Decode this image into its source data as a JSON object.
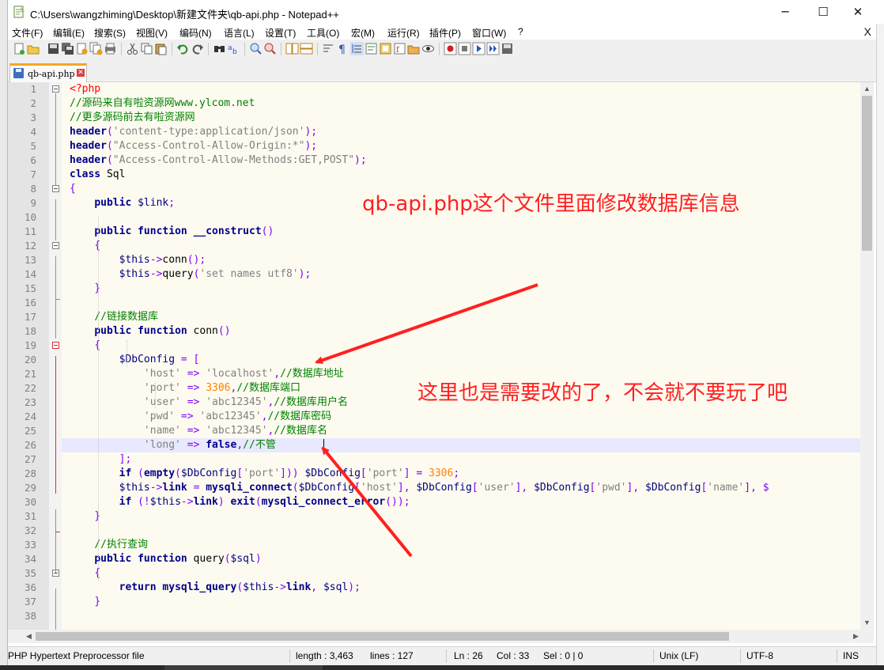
{
  "window": {
    "title": "C:\\Users\\wangzhiming\\Desktop\\新建文件夹\\qb-api.php - Notepad++",
    "minimize": "─",
    "maximize": "☐",
    "close": "✕"
  },
  "menu": {
    "items": [
      "文件(F)",
      "编辑(E)",
      "搜索(S)",
      "视图(V)",
      "编码(N)",
      "语言(L)",
      "设置(T)",
      "工具(O)",
      "宏(M)",
      "运行(R)",
      "插件(P)",
      "窗口(W)",
      "?"
    ],
    "close_doc": "X"
  },
  "toolbar": {
    "icons": [
      "new-file-icon",
      "open-file-icon",
      "save-icon",
      "save-all-icon",
      "close-icon",
      "close-all-icon",
      "print-icon",
      "cut-icon",
      "copy-icon",
      "paste-icon",
      "undo-icon",
      "redo-icon",
      "find-icon",
      "replace-icon",
      "zoom-in-icon",
      "zoom-out-icon",
      "sync-vertical-icon",
      "sync-horizontal-icon",
      "word-wrap-icon",
      "show-all-chars-icon",
      "indent-guide-icon",
      "user-language-icon",
      "doc-map-icon",
      "function-list-icon",
      "folder-workspace-icon",
      "monitoring-icon",
      "record-macro-icon",
      "stop-macro-icon",
      "play-macro-icon",
      "run-macro-multiple-icon",
      "save-macro-icon"
    ]
  },
  "tab": {
    "label": "qb-api.php",
    "close_glyph": "✕"
  },
  "editor": {
    "lines": [
      {
        "n": "1",
        "tokens": [
          [
            "tag",
            "<?php"
          ]
        ]
      },
      {
        "n": "2",
        "tokens": [
          [
            "cmt",
            "//源码来自有啦资源网www.ylcom.net"
          ]
        ]
      },
      {
        "n": "3",
        "tokens": [
          [
            "cmt",
            "//更多源码前去有啦资源网"
          ]
        ]
      },
      {
        "n": "4",
        "tokens": [
          [
            "fn",
            "header"
          ],
          [
            "op",
            "("
          ],
          [
            "str",
            "'content-type:application/json'"
          ],
          [
            "op",
            ");"
          ]
        ]
      },
      {
        "n": "5",
        "tokens": [
          [
            "fn",
            "header"
          ],
          [
            "op",
            "("
          ],
          [
            "str",
            "\"Access-Control-Allow-Origin:*\""
          ],
          [
            "op",
            ");"
          ]
        ]
      },
      {
        "n": "6",
        "tokens": [
          [
            "fn",
            "header"
          ],
          [
            "op",
            "("
          ],
          [
            "str",
            "\"Access-Control-Allow-Methods:GET,POST\""
          ],
          [
            "op",
            ");"
          ]
        ]
      },
      {
        "n": "7",
        "tokens": [
          [
            "kw",
            "class"
          ],
          [
            "plain",
            " Sql"
          ]
        ]
      },
      {
        "n": "8",
        "tokens": [
          [
            "op",
            "{"
          ]
        ]
      },
      {
        "n": "9",
        "tokens": [
          [
            "plain",
            "    "
          ],
          [
            "kw",
            "public"
          ],
          [
            "plain",
            " "
          ],
          [
            "var",
            "$link"
          ],
          [
            "op",
            ";"
          ]
        ]
      },
      {
        "n": "10",
        "tokens": []
      },
      {
        "n": "11",
        "tokens": [
          [
            "plain",
            "    "
          ],
          [
            "kw",
            "public"
          ],
          [
            "plain",
            " "
          ],
          [
            "kw",
            "function"
          ],
          [
            "plain",
            " "
          ],
          [
            "fn",
            "__construct"
          ],
          [
            "op",
            "()"
          ]
        ]
      },
      {
        "n": "12",
        "tokens": [
          [
            "plain",
            "    "
          ],
          [
            "op",
            "{"
          ]
        ]
      },
      {
        "n": "13",
        "tokens": [
          [
            "plain",
            "        "
          ],
          [
            "var",
            "$this"
          ],
          [
            "op",
            "->"
          ],
          [
            "plain",
            "conn"
          ],
          [
            "op",
            "();"
          ]
        ]
      },
      {
        "n": "14",
        "tokens": [
          [
            "plain",
            "        "
          ],
          [
            "var",
            "$this"
          ],
          [
            "op",
            "->"
          ],
          [
            "plain",
            "query"
          ],
          [
            "op",
            "("
          ],
          [
            "str",
            "'set names utf8'"
          ],
          [
            "op",
            ");"
          ]
        ]
      },
      {
        "n": "15",
        "tokens": [
          [
            "plain",
            "    "
          ],
          [
            "op",
            "}"
          ]
        ]
      },
      {
        "n": "16",
        "tokens": []
      },
      {
        "n": "17",
        "tokens": [
          [
            "plain",
            "    "
          ],
          [
            "cmt",
            "//链接数据库"
          ]
        ]
      },
      {
        "n": "18",
        "tokens": [
          [
            "plain",
            "    "
          ],
          [
            "kw",
            "public"
          ],
          [
            "plain",
            " "
          ],
          [
            "kw",
            "function"
          ],
          [
            "plain",
            " conn"
          ],
          [
            "op",
            "()"
          ]
        ]
      },
      {
        "n": "19",
        "tokens": [
          [
            "plain",
            "    "
          ],
          [
            "op",
            "{"
          ]
        ]
      },
      {
        "n": "20",
        "tokens": [
          [
            "plain",
            "        "
          ],
          [
            "var",
            "$DbConfig"
          ],
          [
            "plain",
            " "
          ],
          [
            "op",
            "= ["
          ]
        ]
      },
      {
        "n": "21",
        "tokens": [
          [
            "plain",
            "            "
          ],
          [
            "str",
            "'host'"
          ],
          [
            "plain",
            " "
          ],
          [
            "op",
            "=>"
          ],
          [
            "plain",
            " "
          ],
          [
            "str",
            "'localhost'"
          ],
          [
            "op",
            ","
          ],
          [
            "cmt",
            "//数据库地址"
          ]
        ]
      },
      {
        "n": "22",
        "tokens": [
          [
            "plain",
            "            "
          ],
          [
            "str",
            "'port'"
          ],
          [
            "plain",
            " "
          ],
          [
            "op",
            "=>"
          ],
          [
            "plain",
            " "
          ],
          [
            "num",
            "3306"
          ],
          [
            "op",
            ","
          ],
          [
            "cmt",
            "//数据库端口"
          ]
        ]
      },
      {
        "n": "23",
        "tokens": [
          [
            "plain",
            "            "
          ],
          [
            "str",
            "'user'"
          ],
          [
            "plain",
            " "
          ],
          [
            "op",
            "=>"
          ],
          [
            "plain",
            " "
          ],
          [
            "str",
            "'abc12345'"
          ],
          [
            "op",
            ","
          ],
          [
            "cmt",
            "//数据库用户名"
          ]
        ]
      },
      {
        "n": "24",
        "tokens": [
          [
            "plain",
            "            "
          ],
          [
            "str",
            "'pwd'"
          ],
          [
            "plain",
            " "
          ],
          [
            "op",
            "=>"
          ],
          [
            "plain",
            " "
          ],
          [
            "str",
            "'abc12345'"
          ],
          [
            "op",
            ","
          ],
          [
            "cmt",
            "//数据库密码"
          ]
        ]
      },
      {
        "n": "25",
        "tokens": [
          [
            "plain",
            "            "
          ],
          [
            "str",
            "'name'"
          ],
          [
            "plain",
            " "
          ],
          [
            "op",
            "=>"
          ],
          [
            "plain",
            " "
          ],
          [
            "str",
            "'abc12345'"
          ],
          [
            "op",
            ","
          ],
          [
            "cmt",
            "//数据库名"
          ]
        ]
      },
      {
        "n": "26",
        "tokens": [
          [
            "plain",
            "            "
          ],
          [
            "str",
            "'long'"
          ],
          [
            "plain",
            " "
          ],
          [
            "op",
            "=>"
          ],
          [
            "plain",
            " "
          ],
          [
            "kw",
            "false"
          ],
          [
            "op",
            ","
          ],
          [
            "cmt",
            "//不管"
          ]
        ]
      },
      {
        "n": "27",
        "tokens": [
          [
            "plain",
            "        "
          ],
          [
            "op",
            "];"
          ]
        ]
      },
      {
        "n": "28",
        "tokens": [
          [
            "plain",
            "        "
          ],
          [
            "kw",
            "if"
          ],
          [
            "plain",
            " "
          ],
          [
            "op",
            "("
          ],
          [
            "fn",
            "empty"
          ],
          [
            "op",
            "("
          ],
          [
            "var",
            "$DbConfig"
          ],
          [
            "op",
            "["
          ],
          [
            "str",
            "'port'"
          ],
          [
            "op",
            "])) "
          ],
          [
            "var",
            "$DbConfig"
          ],
          [
            "op",
            "["
          ],
          [
            "str",
            "'port'"
          ],
          [
            "op",
            "] = "
          ],
          [
            "num",
            "3306"
          ],
          [
            "op",
            ";"
          ]
        ]
      },
      {
        "n": "29",
        "tokens": [
          [
            "plain",
            "        "
          ],
          [
            "var",
            "$this"
          ],
          [
            "op",
            "->"
          ],
          [
            "fn",
            "link"
          ],
          [
            "plain",
            " "
          ],
          [
            "op",
            "="
          ],
          [
            "plain",
            " "
          ],
          [
            "fn",
            "mysqli_connect"
          ],
          [
            "op",
            "("
          ],
          [
            "var",
            "$DbConfig"
          ],
          [
            "op",
            "["
          ],
          [
            "str",
            "'host'"
          ],
          [
            "op",
            "], "
          ],
          [
            "var",
            "$DbConfig"
          ],
          [
            "op",
            "["
          ],
          [
            "str",
            "'user'"
          ],
          [
            "op",
            "], "
          ],
          [
            "var",
            "$DbConfig"
          ],
          [
            "op",
            "["
          ],
          [
            "str",
            "'pwd'"
          ],
          [
            "op",
            "], "
          ],
          [
            "var",
            "$DbConfig"
          ],
          [
            "op",
            "["
          ],
          [
            "str",
            "'name'"
          ],
          [
            "op",
            "], $"
          ]
        ]
      },
      {
        "n": "30",
        "tokens": [
          [
            "plain",
            "        "
          ],
          [
            "kw",
            "if"
          ],
          [
            "plain",
            " "
          ],
          [
            "op",
            "(!"
          ],
          [
            "var",
            "$this"
          ],
          [
            "op",
            "->"
          ],
          [
            "fn",
            "link"
          ],
          [
            "op",
            ")"
          ],
          [
            "plain",
            " "
          ],
          [
            "fn",
            "exit"
          ],
          [
            "op",
            "("
          ],
          [
            "fn",
            "mysqli_connect_error"
          ],
          [
            "op",
            "());"
          ]
        ]
      },
      {
        "n": "31",
        "tokens": [
          [
            "plain",
            "    "
          ],
          [
            "op",
            "}"
          ]
        ]
      },
      {
        "n": "32",
        "tokens": []
      },
      {
        "n": "33",
        "tokens": [
          [
            "plain",
            "    "
          ],
          [
            "cmt",
            "//执行查询"
          ]
        ]
      },
      {
        "n": "34",
        "tokens": [
          [
            "plain",
            "    "
          ],
          [
            "kw",
            "public"
          ],
          [
            "plain",
            " "
          ],
          [
            "kw",
            "function"
          ],
          [
            "plain",
            " query"
          ],
          [
            "op",
            "("
          ],
          [
            "var",
            "$sql"
          ],
          [
            "op",
            ")"
          ]
        ]
      },
      {
        "n": "35",
        "tokens": [
          [
            "plain",
            "    "
          ],
          [
            "op",
            "{"
          ]
        ]
      },
      {
        "n": "36",
        "tokens": [
          [
            "plain",
            "        "
          ],
          [
            "kw",
            "return"
          ],
          [
            "plain",
            " "
          ],
          [
            "fn",
            "mysqli_query"
          ],
          [
            "op",
            "("
          ],
          [
            "var",
            "$this"
          ],
          [
            "op",
            "->"
          ],
          [
            "fn",
            "link"
          ],
          [
            "op",
            ","
          ],
          [
            "plain",
            " "
          ],
          [
            "var",
            "$sql"
          ],
          [
            "op",
            ");"
          ]
        ]
      },
      {
        "n": "37",
        "tokens": [
          [
            "plain",
            "    "
          ],
          [
            "op",
            "}"
          ]
        ]
      },
      {
        "n": "38",
        "tokens": []
      }
    ],
    "current_line": "26"
  },
  "annotations": {
    "text1": "qb-api.php这个文件里面修改数据库信息",
    "text2": "这里也是需要改的了，不会就不要玩了吧",
    "color": "#ff2020"
  },
  "statusbar": {
    "file_type": "PHP Hypertext Preprocessor file",
    "length": "length : 3,463",
    "lines": "lines : 127",
    "ln": "Ln : 26",
    "col": "Col : 33",
    "sel": "Sel : 0 | 0",
    "eol": "Unix (LF)",
    "encoding": "UTF-8",
    "mode": "INS"
  },
  "colors": {
    "keyword": "#00008b",
    "string": "#808080",
    "comment": "#008000",
    "number": "#ff8000",
    "operator": "#8000ff",
    "php_tag": "#ff0000",
    "current_line_bg": "#e8e8ff",
    "tab_accent": "#f5a623"
  }
}
